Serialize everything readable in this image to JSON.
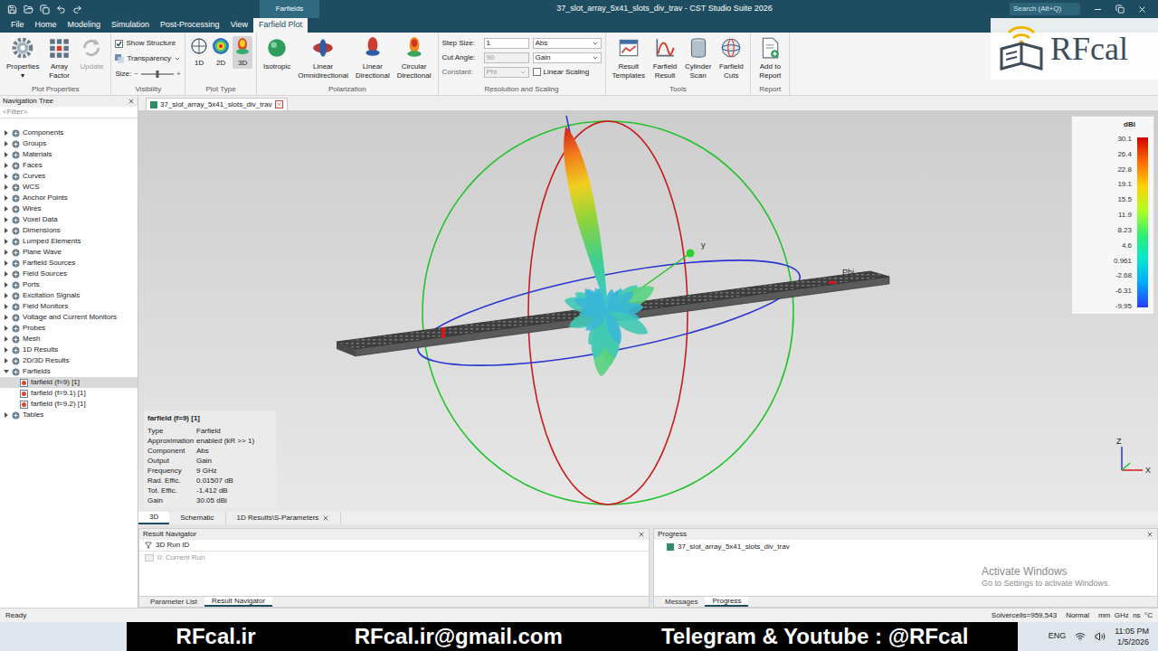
{
  "window": {
    "title": "37_slot_array_5x41_slots_div_trav - CST Studio Suite 2026",
    "context_group": "Farfields",
    "search": "Search (Alt+Q)"
  },
  "menu_tabs": [
    {
      "label": "File",
      "selected": false
    },
    {
      "label": "Home",
      "selected": false
    },
    {
      "label": "Modeling",
      "selected": false
    },
    {
      "label": "Simulation",
      "selected": false
    },
    {
      "label": "Post-Processing",
      "selected": false
    },
    {
      "label": "View",
      "selected": false
    },
    {
      "label": "Farfield Plot",
      "selected": true
    }
  ],
  "ribbon": {
    "plot_properties": {
      "label": "Plot Properties",
      "buttons": [
        {
          "lines": [
            "Properties"
          ],
          "disabled": false,
          "dropdown": "▾"
        },
        {
          "lines": [
            "Array",
            "Factor"
          ],
          "disabled": false
        },
        {
          "lines": [
            "Update"
          ],
          "disabled": true
        }
      ]
    },
    "visibility": {
      "label": "Visibility",
      "show_structure": {
        "label": "Show Structure",
        "checked": true
      },
      "transparency": {
        "label": "Transparency"
      },
      "size": {
        "label": "Size:",
        "level": 0.5,
        "minus": "−",
        "plus": "+"
      }
    },
    "plot_type": {
      "label": "Plot Type",
      "buttons": [
        {
          "label": "1D",
          "selected": false
        },
        {
          "label": "2D",
          "selected": false
        },
        {
          "label": "3D",
          "selected": true
        }
      ]
    },
    "polarization": {
      "label": "Polarization",
      "buttons": [
        {
          "lines": [
            "Isotropic"
          ],
          "disabled": false
        },
        {
          "lines": [
            "Linear",
            "Omnidirectional"
          ],
          "disabled": false
        },
        {
          "lines": [
            "Linear",
            "Directional"
          ],
          "disabled": false
        },
        {
          "lines": [
            "Circular",
            "Directional"
          ],
          "disabled": false
        }
      ]
    },
    "resolution": {
      "label": "Resolution and Scaling",
      "fields": [
        {
          "label": "Step Size:",
          "kind": "input-select",
          "value": "1",
          "disabled": false,
          "select": "Abs"
        },
        {
          "label": "Cut Angle:",
          "kind": "input-select",
          "value": "90",
          "disabled": true,
          "select": "Gain"
        },
        {
          "label": "Constant:",
          "kind": "select",
          "value": "Phi",
          "disabled": true,
          "select": ""
        }
      ],
      "linear_scaling": {
        "label": "Linear Scaling",
        "checked": false
      }
    },
    "tools": {
      "label": "Tools",
      "buttons": [
        {
          "lines": [
            "Result",
            "Templates"
          ],
          "disabled": false
        },
        {
          "lines": [
            "Farfield",
            "Result"
          ],
          "disabled": false
        },
        {
          "lines": [
            "Cylinder",
            "Scan"
          ],
          "disabled": false
        },
        {
          "lines": [
            "Farfield",
            "Cuts"
          ],
          "disabled": false
        }
      ]
    },
    "report": {
      "label": "Report",
      "buttons": [
        {
          "lines": [
            "Add to",
            "Report"
          ],
          "disabled": false
        }
      ]
    }
  },
  "navigation_tree": {
    "title": "Navigation Tree",
    "filter": "<Filter>",
    "items": [
      {
        "label": "Components",
        "expanded": false,
        "children": []
      },
      {
        "label": "Groups",
        "expanded": false,
        "children": []
      },
      {
        "label": "Materials",
        "expanded": false,
        "children": []
      },
      {
        "label": "Faces",
        "expanded": false,
        "children": []
      },
      {
        "label": "Curves",
        "expanded": false,
        "children": []
      },
      {
        "label": "WCS",
        "expanded": false,
        "children": []
      },
      {
        "label": "Anchor Points",
        "expanded": false,
        "children": []
      },
      {
        "label": "Wires",
        "expanded": false,
        "children": []
      },
      {
        "label": "Voxel Data",
        "expanded": false,
        "children": []
      },
      {
        "label": "Dimensions",
        "expanded": false,
        "children": []
      },
      {
        "label": "Lumped Elements",
        "expanded": false,
        "children": []
      },
      {
        "label": "Plane Wave",
        "expanded": false,
        "children": []
      },
      {
        "label": "Farfield Sources",
        "expanded": false,
        "children": []
      },
      {
        "label": "Field Sources",
        "expanded": false,
        "children": []
      },
      {
        "label": "Ports",
        "expanded": false,
        "children": []
      },
      {
        "label": "Excitation Signals",
        "expanded": false,
        "children": []
      },
      {
        "label": "Field Monitors",
        "expanded": false,
        "children": []
      },
      {
        "label": "Voltage and Current Monitors",
        "expanded": false,
        "children": []
      },
      {
        "label": "Probes",
        "expanded": false,
        "children": []
      },
      {
        "label": "Mesh",
        "expanded": false,
        "children": []
      },
      {
        "label": "1D Results",
        "expanded": false,
        "children": []
      },
      {
        "label": "2D/3D Results",
        "expanded": false,
        "children": []
      },
      {
        "label": "Farfields",
        "expanded": true,
        "children": [
          {
            "label": "farfield (f=9) [1]",
            "selected": true
          },
          {
            "label": "farfield (f=9.1) [1]",
            "selected": false
          },
          {
            "label": "farfield (f=9.2) [1]",
            "selected": false
          }
        ]
      },
      {
        "label": "Tables",
        "expanded": false,
        "children": []
      }
    ]
  },
  "document_tab": {
    "label": "37_slot_array_5x41_slots_div_trav",
    "closable": true
  },
  "view": {
    "info": {
      "title": "farfield (f=9) [1]",
      "rows": [
        [
          "Type",
          "Farfield"
        ],
        [
          "Approximation",
          "enabled (kR >> 1)"
        ],
        [
          "Component",
          "Abs"
        ],
        [
          "Output",
          "Gain"
        ],
        [
          "Frequency",
          "9 GHz"
        ],
        [
          "Rad. Effic.",
          "0.01507 dB"
        ],
        [
          "Tot. Effic.",
          "-1.412 dB"
        ],
        [
          "Gain",
          "30.05 dBi"
        ]
      ]
    },
    "legend": {
      "unit": "dBi",
      "ticks": [
        "30.1",
        "26.4",
        "22.8",
        "19.1",
        "15.5",
        "11.9",
        "8.23",
        "4.6",
        "0.961",
        "-2.68",
        "-6.31",
        "-9.95"
      ]
    },
    "labels": {
      "y": "y",
      "phi": "Phi"
    },
    "triad": {
      "z": "Z",
      "x": "X"
    }
  },
  "bottom_tabs": [
    {
      "label": "3D",
      "selected": true,
      "closable": false
    },
    {
      "label": "Schematic",
      "selected": false,
      "closable": false
    },
    {
      "label": "1D Results\\S-Parameters",
      "selected": false,
      "closable": true
    }
  ],
  "result_navigator": {
    "title": "Result Navigator",
    "column": "3D Run ID",
    "rows": [
      {
        "label": "0: Current Run",
        "disabled": true
      }
    ],
    "tabs": [
      {
        "label": "Parameter List",
        "selected": false
      },
      {
        "label": "Result Navigator",
        "selected": true
      }
    ]
  },
  "progress": {
    "title": "Progress",
    "items": [
      "37_slot_array_5x41_slots_div_trav"
    ],
    "tabs": [
      {
        "label": "Messages",
        "selected": false
      },
      {
        "label": "Progress",
        "selected": true
      }
    ]
  },
  "activation": {
    "title": "Activate Windows",
    "subtitle": "Go to Settings to activate Windows."
  },
  "status_bar": {
    "left": "Ready",
    "right": [
      "Solvercells=959,543",
      "Normal",
      "mm  GHz  ns  °C"
    ]
  },
  "taskbar": {
    "language": "ENG",
    "time": "11:05 PM",
    "date": "1/5/2026"
  },
  "watermark": {
    "logo": "RFcal",
    "banner": [
      "RFcal.ir",
      "RFcal.ir@gmail.com",
      "Telegram & Youtube : @RFcal"
    ]
  }
}
